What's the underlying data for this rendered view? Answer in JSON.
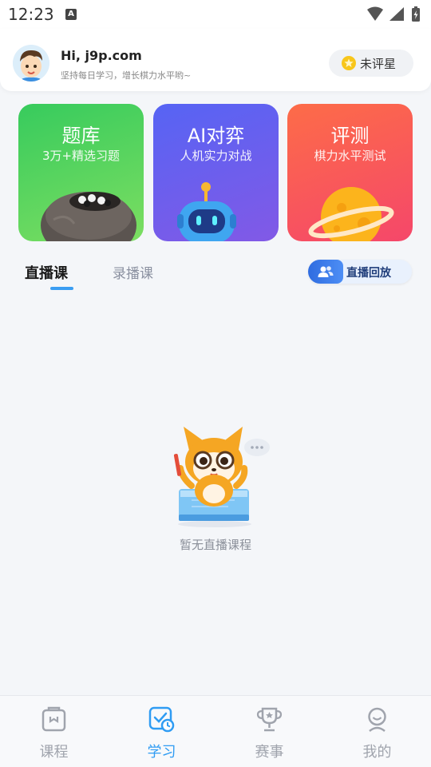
{
  "status_bar": {
    "time": "12:23",
    "notification_icon": "A"
  },
  "header": {
    "greeting": "Hi, j9p.com",
    "motto": "坚持每日学习，增长棋力水平哟~",
    "rating_label": "未评星"
  },
  "cards": [
    {
      "title": "题库",
      "subtitle": "3万+精选习题",
      "icon": "go-stone-bowl"
    },
    {
      "title": "AI对弈",
      "subtitle": "人机实力对战",
      "icon": "robot"
    },
    {
      "title": "评测",
      "subtitle": "棋力水平测试",
      "icon": "planet"
    }
  ],
  "tabs": {
    "live": "直播课",
    "recorded": "录播课",
    "active": "live"
  },
  "replay_button": "直播回放",
  "empty_state": {
    "text": "暂无直播课程",
    "icon": "fox-mascot"
  },
  "bottom_nav": [
    {
      "label": "课程",
      "icon": "course-icon",
      "active": false
    },
    {
      "label": "学习",
      "icon": "study-icon",
      "active": true
    },
    {
      "label": "赛事",
      "icon": "trophy-icon",
      "active": false
    },
    {
      "label": "我的",
      "icon": "profile-icon",
      "active": false
    }
  ],
  "colors": {
    "accent": "#2f9cf3",
    "card_bank": "#37cb5d",
    "card_ai": "#5664f4",
    "card_eval": "#fd6c48"
  }
}
